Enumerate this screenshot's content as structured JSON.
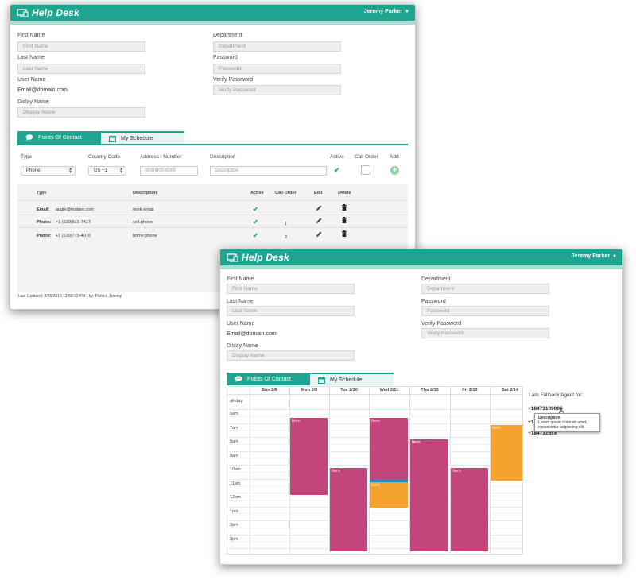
{
  "app": {
    "title": "Help Desk",
    "user": "Jeremy Parker",
    "colors": {
      "accent": "#1fa58f",
      "accent_light": "#a9ddd3",
      "check": "#1fa58f",
      "add": "#8fd6a0"
    }
  },
  "form": {
    "first_name": {
      "label": "First Name",
      "placeholder": "First Name"
    },
    "last_name": {
      "label": "Last Name",
      "placeholder": "Last Name"
    },
    "user_name": {
      "label": "User Name",
      "value": "Email@domain.com"
    },
    "display_name": {
      "label": "Dislay Name",
      "placeholder": "Display Name"
    },
    "department": {
      "label": "Department",
      "placeholder": "Department"
    },
    "password": {
      "label": "Password",
      "placeholder": "Password"
    },
    "verify_password": {
      "label": "Verify Password",
      "placeholder": "Verify Password"
    }
  },
  "tabs": [
    {
      "label": "Points Of Contact",
      "icon": "chat-bubble-icon"
    },
    {
      "label": "My Schedule",
      "icon": "calendar-icon"
    }
  ],
  "contact_form": {
    "headers": {
      "type": "Type",
      "country": "Country Code",
      "address": "Address / Number",
      "description": "Description",
      "active": "Active",
      "call_order": "Call Order",
      "add": "Add"
    },
    "type_value": "Phone",
    "country_value": "US +1",
    "address_placeholder": "(000)000-0000",
    "description_placeholder": "Description"
  },
  "contact_list": {
    "headers": {
      "type": "Type",
      "description": "Description",
      "active": "Active",
      "call_order": "Call Order",
      "edit": "Edit",
      "delete": "Delete"
    },
    "rows": [
      {
        "type": "Email:",
        "value": "augie@mutare.com",
        "description": "work email",
        "active": true,
        "call_order": ""
      },
      {
        "type": "Phone:",
        "value": "+1 (630)510-7417",
        "description": "cell phone",
        "active": true,
        "call_order": "1"
      },
      {
        "type": "Phone:",
        "value": "+1 (630)779-4070",
        "description": "home phone",
        "active": true,
        "call_order": "2"
      }
    ]
  },
  "footer": "Last Updated: 8/25/2015 12:58:32 PM | by: Parker, Jeremy",
  "calendar": {
    "days": [
      "Sun 2/8",
      "Mon 2/9",
      "Tue 2/10",
      "Wed 2/11",
      "Thu 2/12",
      "Fri 2/13",
      "Sat 2/14"
    ],
    "allday_label": "all-day",
    "times": [
      "6am",
      "7am",
      "8am",
      "9am",
      "10am",
      "11am",
      "12pm",
      "1pm",
      "2pm",
      "3pm"
    ],
    "events": [
      {
        "label": "Item",
        "color": "#c2457c"
      },
      {
        "label": "Item",
        "color": "#c2457c"
      },
      {
        "label": "Item",
        "color": "#1a86c8"
      },
      {
        "label": "Item",
        "color": "#c2457c"
      },
      {
        "label": "Item",
        "color": "#f5a12e"
      },
      {
        "label": "Item",
        "color": "#c2457c"
      },
      {
        "label": "Item",
        "color": "#c2457c"
      },
      {
        "label": "Item",
        "color": "#f5a12e"
      }
    ]
  },
  "fallback": {
    "title": "I am Fallback Agent for:",
    "numbers": [
      "+18473109006",
      "+1",
      "+1847315xx"
    ],
    "tooltip_title": "Description",
    "tooltip_text": "Lorem ipsum dolor sit amet, consectetur adipiscing elit."
  }
}
